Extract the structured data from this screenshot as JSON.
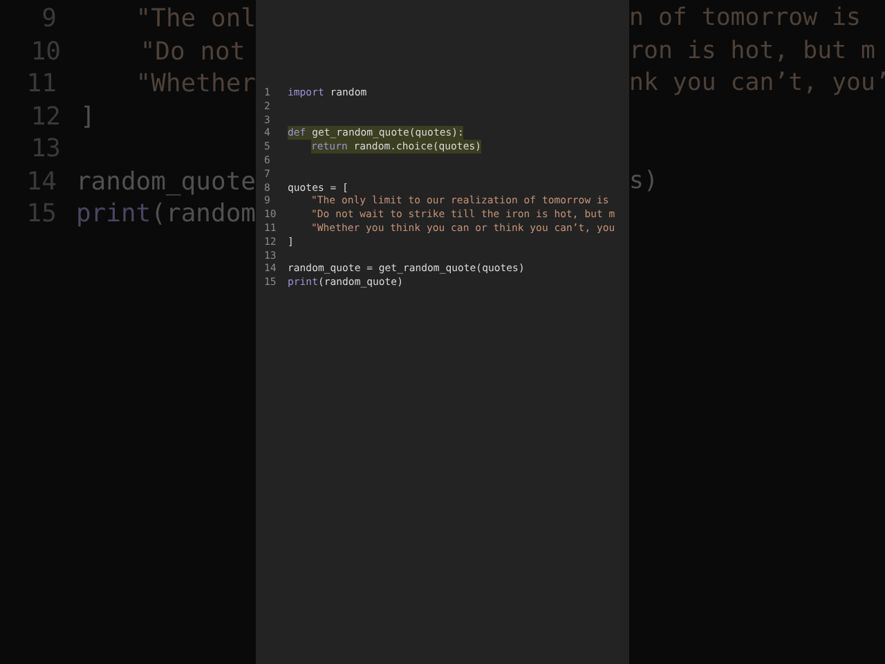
{
  "backdrop": {
    "lines": [
      {
        "number": "9",
        "left": [
          {
            "kind": "string",
            "text": "    \"The onl"
          }
        ],
        "right": [
          {
            "kind": "string",
            "text": "n of tomorrow is"
          }
        ]
      },
      {
        "number": "10",
        "left": [
          {
            "kind": "string",
            "text": "    \"Do not"
          }
        ],
        "right": [
          {
            "kind": "string",
            "text": "ron is hot, but m"
          }
        ]
      },
      {
        "number": "11",
        "left": [
          {
            "kind": "string",
            "text": "    \"Whether"
          }
        ],
        "right": [
          {
            "kind": "string",
            "text": "nk you can’t, you’"
          }
        ]
      },
      {
        "number": "12",
        "left": [
          {
            "kind": "plain",
            "text": "]"
          }
        ]
      },
      {
        "number": "13"
      },
      {
        "number": "14",
        "left": [
          {
            "kind": "plain",
            "text": "random_quote"
          }
        ],
        "right": [
          {
            "kind": "plain",
            "text": "s)"
          }
        ]
      },
      {
        "number": "15",
        "left": [
          {
            "kind": "keyword",
            "text": "print"
          },
          {
            "kind": "plain",
            "text": "(random"
          }
        ]
      }
    ]
  },
  "editor": {
    "lines": [
      {
        "number": "1",
        "highlighted": false,
        "tokens": [
          {
            "kind": "keyword",
            "text": "import"
          },
          {
            "kind": "plain",
            "text": " random"
          }
        ]
      },
      {
        "number": "2",
        "highlighted": false
      },
      {
        "number": "3",
        "highlighted": false
      },
      {
        "number": "4",
        "highlighted": true,
        "tokens": [
          {
            "kind": "keyword",
            "text": "def"
          },
          {
            "kind": "plain",
            "text": " get_random_quote(quotes):"
          }
        ],
        "children": [
          {
            "number": "5",
            "highlighted": true,
            "tokens": [
              {
                "kind": "keyword",
                "text": "return"
              },
              {
                "kind": "plain",
                "text": " random.choice(quotes)"
              }
            ]
          }
        ]
      },
      {
        "number": "6",
        "highlighted": false
      },
      {
        "number": "7",
        "highlighted": false
      },
      {
        "number": "8",
        "highlighted": false,
        "tokens": [
          {
            "kind": "plain",
            "text": "quotes = ["
          }
        ],
        "children": [
          {
            "number": "9",
            "highlighted": false,
            "tokens": [
              {
                "kind": "string",
                "text": "\"The only limit to our realization of tomorrow is"
              }
            ]
          },
          {
            "number": "10",
            "highlighted": false,
            "tokens": [
              {
                "kind": "string",
                "text": "\"Do not wait to strike till the iron is hot, but m"
              }
            ]
          },
          {
            "number": "11",
            "highlighted": false,
            "tokens": [
              {
                "kind": "string",
                "text": "\"Whether you think you can or think you can’t, you"
              }
            ]
          }
        ]
      },
      {
        "number": "12",
        "highlighted": false,
        "tokens": [
          {
            "kind": "plain",
            "text": "]"
          }
        ]
      },
      {
        "number": "13",
        "highlighted": false
      },
      {
        "number": "14",
        "highlighted": false,
        "tokens": [
          {
            "kind": "plain",
            "text": "random_quote = get_random_quote(quotes)"
          }
        ]
      },
      {
        "number": "15",
        "highlighted": false,
        "tokens": [
          {
            "kind": "keyword",
            "text": "print"
          },
          {
            "kind": "plain",
            "text": "(random_quote)"
          }
        ]
      }
    ]
  }
}
